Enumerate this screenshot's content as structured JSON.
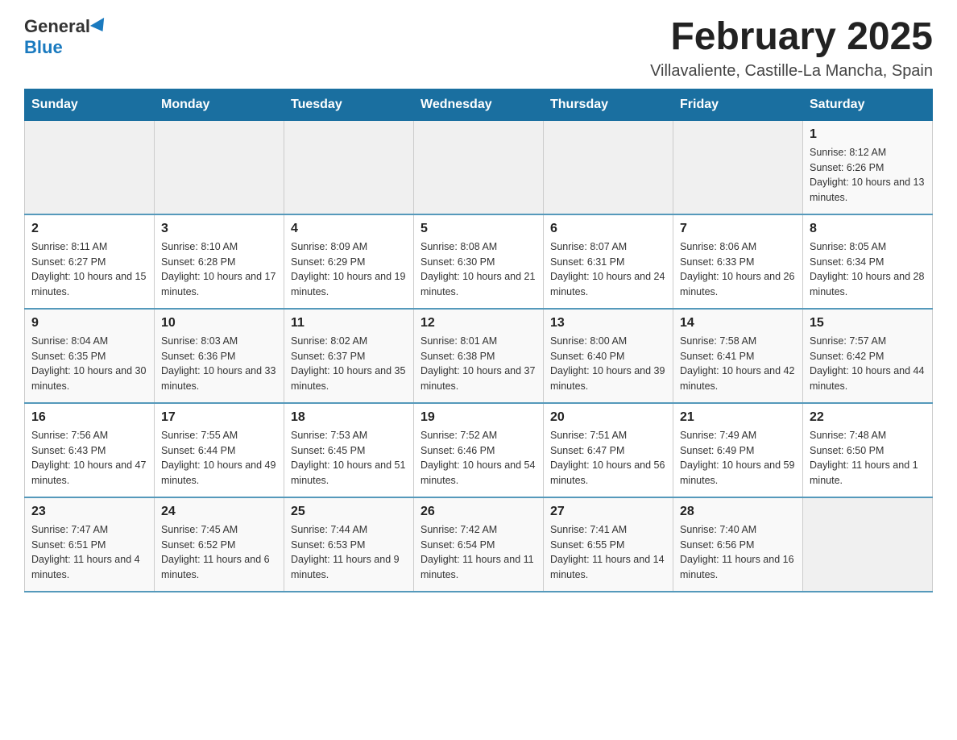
{
  "logo": {
    "general": "General",
    "blue": "Blue"
  },
  "title": "February 2025",
  "location": "Villavaliente, Castille-La Mancha, Spain",
  "days_of_week": [
    "Sunday",
    "Monday",
    "Tuesday",
    "Wednesday",
    "Thursday",
    "Friday",
    "Saturday"
  ],
  "weeks": [
    [
      {
        "day": "",
        "info": ""
      },
      {
        "day": "",
        "info": ""
      },
      {
        "day": "",
        "info": ""
      },
      {
        "day": "",
        "info": ""
      },
      {
        "day": "",
        "info": ""
      },
      {
        "day": "",
        "info": ""
      },
      {
        "day": "1",
        "info": "Sunrise: 8:12 AM\nSunset: 6:26 PM\nDaylight: 10 hours and 13 minutes."
      }
    ],
    [
      {
        "day": "2",
        "info": "Sunrise: 8:11 AM\nSunset: 6:27 PM\nDaylight: 10 hours and 15 minutes."
      },
      {
        "day": "3",
        "info": "Sunrise: 8:10 AM\nSunset: 6:28 PM\nDaylight: 10 hours and 17 minutes."
      },
      {
        "day": "4",
        "info": "Sunrise: 8:09 AM\nSunset: 6:29 PM\nDaylight: 10 hours and 19 minutes."
      },
      {
        "day": "5",
        "info": "Sunrise: 8:08 AM\nSunset: 6:30 PM\nDaylight: 10 hours and 21 minutes."
      },
      {
        "day": "6",
        "info": "Sunrise: 8:07 AM\nSunset: 6:31 PM\nDaylight: 10 hours and 24 minutes."
      },
      {
        "day": "7",
        "info": "Sunrise: 8:06 AM\nSunset: 6:33 PM\nDaylight: 10 hours and 26 minutes."
      },
      {
        "day": "8",
        "info": "Sunrise: 8:05 AM\nSunset: 6:34 PM\nDaylight: 10 hours and 28 minutes."
      }
    ],
    [
      {
        "day": "9",
        "info": "Sunrise: 8:04 AM\nSunset: 6:35 PM\nDaylight: 10 hours and 30 minutes."
      },
      {
        "day": "10",
        "info": "Sunrise: 8:03 AM\nSunset: 6:36 PM\nDaylight: 10 hours and 33 minutes."
      },
      {
        "day": "11",
        "info": "Sunrise: 8:02 AM\nSunset: 6:37 PM\nDaylight: 10 hours and 35 minutes."
      },
      {
        "day": "12",
        "info": "Sunrise: 8:01 AM\nSunset: 6:38 PM\nDaylight: 10 hours and 37 minutes."
      },
      {
        "day": "13",
        "info": "Sunrise: 8:00 AM\nSunset: 6:40 PM\nDaylight: 10 hours and 39 minutes."
      },
      {
        "day": "14",
        "info": "Sunrise: 7:58 AM\nSunset: 6:41 PM\nDaylight: 10 hours and 42 minutes."
      },
      {
        "day": "15",
        "info": "Sunrise: 7:57 AM\nSunset: 6:42 PM\nDaylight: 10 hours and 44 minutes."
      }
    ],
    [
      {
        "day": "16",
        "info": "Sunrise: 7:56 AM\nSunset: 6:43 PM\nDaylight: 10 hours and 47 minutes."
      },
      {
        "day": "17",
        "info": "Sunrise: 7:55 AM\nSunset: 6:44 PM\nDaylight: 10 hours and 49 minutes."
      },
      {
        "day": "18",
        "info": "Sunrise: 7:53 AM\nSunset: 6:45 PM\nDaylight: 10 hours and 51 minutes."
      },
      {
        "day": "19",
        "info": "Sunrise: 7:52 AM\nSunset: 6:46 PM\nDaylight: 10 hours and 54 minutes."
      },
      {
        "day": "20",
        "info": "Sunrise: 7:51 AM\nSunset: 6:47 PM\nDaylight: 10 hours and 56 minutes."
      },
      {
        "day": "21",
        "info": "Sunrise: 7:49 AM\nSunset: 6:49 PM\nDaylight: 10 hours and 59 minutes."
      },
      {
        "day": "22",
        "info": "Sunrise: 7:48 AM\nSunset: 6:50 PM\nDaylight: 11 hours and 1 minute."
      }
    ],
    [
      {
        "day": "23",
        "info": "Sunrise: 7:47 AM\nSunset: 6:51 PM\nDaylight: 11 hours and 4 minutes."
      },
      {
        "day": "24",
        "info": "Sunrise: 7:45 AM\nSunset: 6:52 PM\nDaylight: 11 hours and 6 minutes."
      },
      {
        "day": "25",
        "info": "Sunrise: 7:44 AM\nSunset: 6:53 PM\nDaylight: 11 hours and 9 minutes."
      },
      {
        "day": "26",
        "info": "Sunrise: 7:42 AM\nSunset: 6:54 PM\nDaylight: 11 hours and 11 minutes."
      },
      {
        "day": "27",
        "info": "Sunrise: 7:41 AM\nSunset: 6:55 PM\nDaylight: 11 hours and 14 minutes."
      },
      {
        "day": "28",
        "info": "Sunrise: 7:40 AM\nSunset: 6:56 PM\nDaylight: 11 hours and 16 minutes."
      },
      {
        "day": "",
        "info": ""
      }
    ]
  ]
}
